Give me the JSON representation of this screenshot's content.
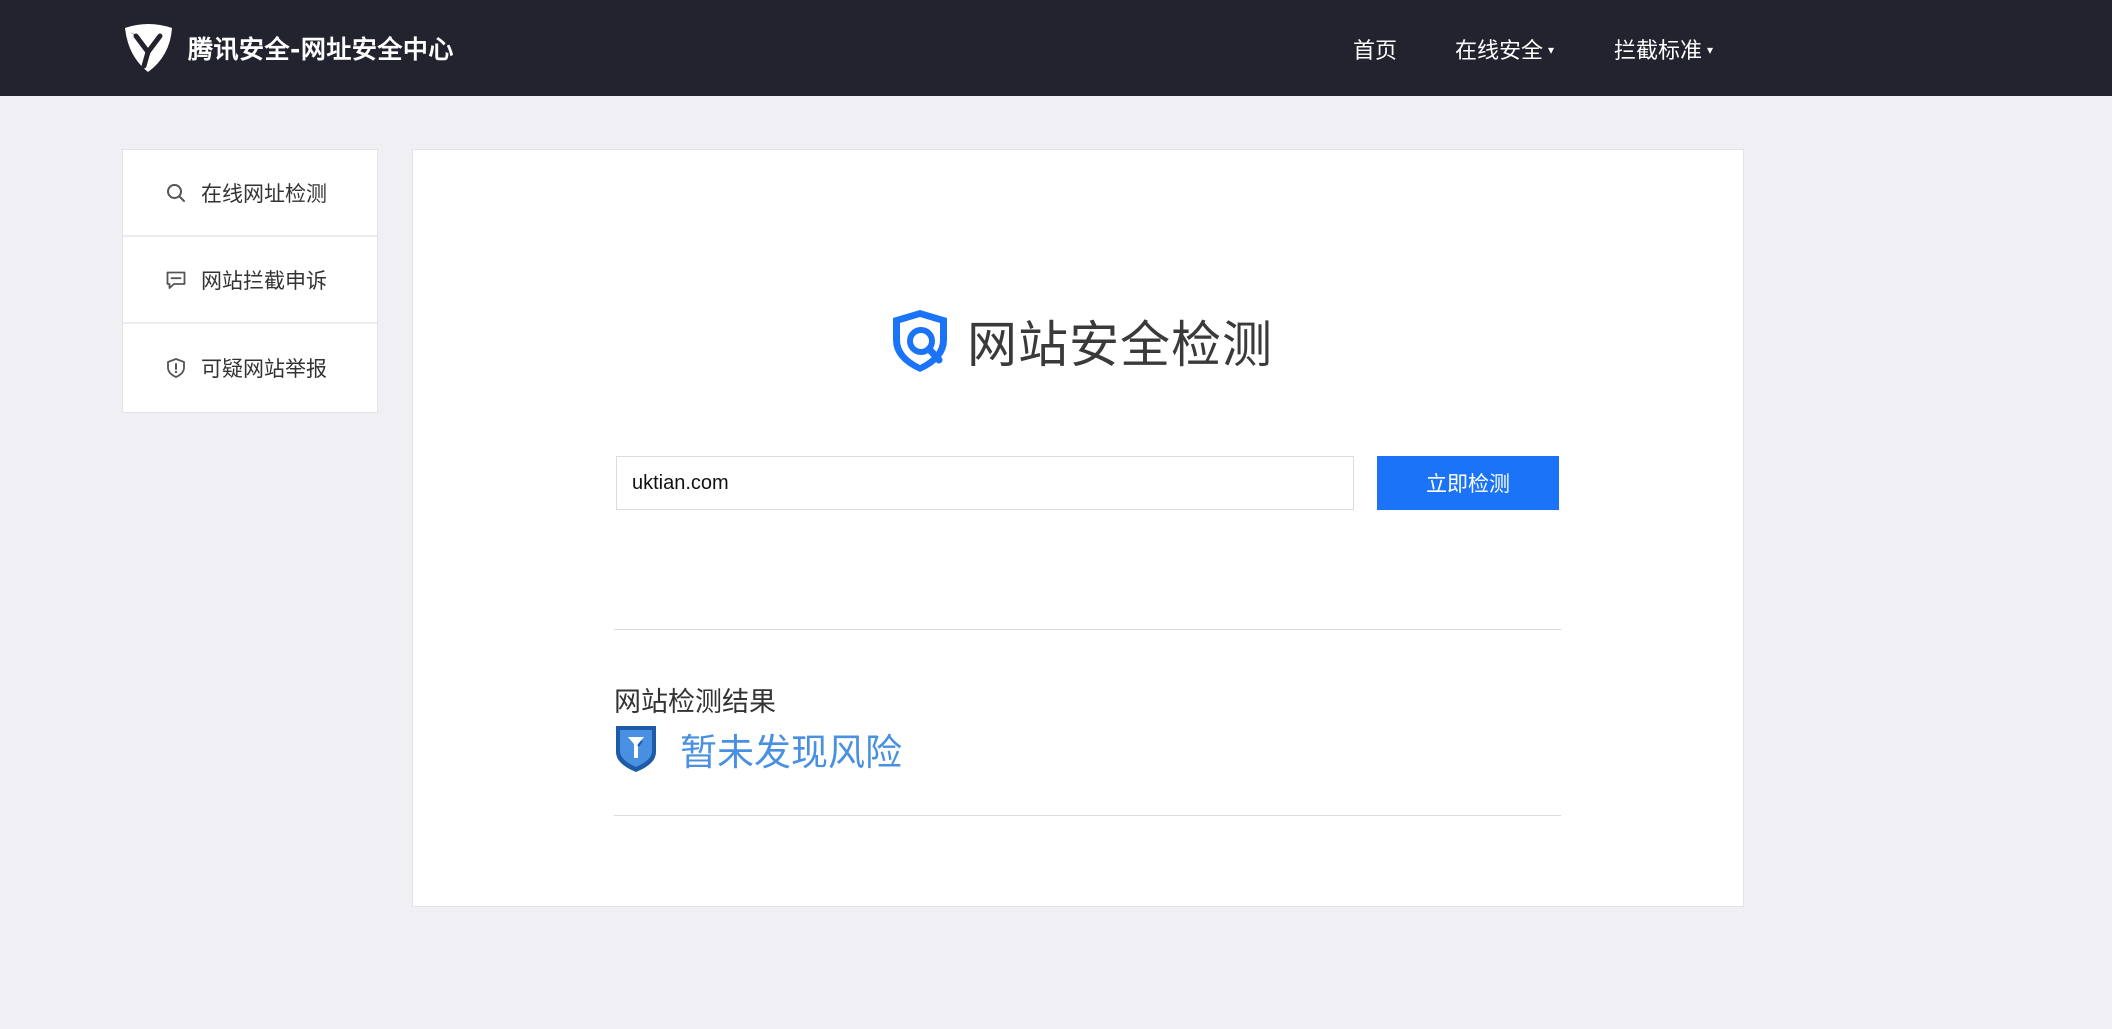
{
  "header": {
    "brand_name": "腾讯安全-网址安全中心",
    "nav": [
      {
        "label": "首页",
        "dropdown": false
      },
      {
        "label": "在线安全",
        "dropdown": true
      },
      {
        "label": "拦截标准",
        "dropdown": true
      }
    ],
    "caret": "▾"
  },
  "sidebar": {
    "items": [
      {
        "label": "在线网址检测",
        "icon": "search-icon"
      },
      {
        "label": "网站拦截申诉",
        "icon": "message-icon"
      },
      {
        "label": "可疑网站举报",
        "icon": "shield-alert-icon"
      }
    ]
  },
  "main": {
    "title": "网站安全检测",
    "url_input_value": "uktian.com",
    "check_button_label": "立即检测",
    "result_heading": "网站检测结果",
    "result_status": "暂未发现风险"
  },
  "colors": {
    "header_bg": "#22232f",
    "page_bg": "#efeff4",
    "accent_blue": "#1b74f7",
    "result_blue": "#4990e2"
  }
}
